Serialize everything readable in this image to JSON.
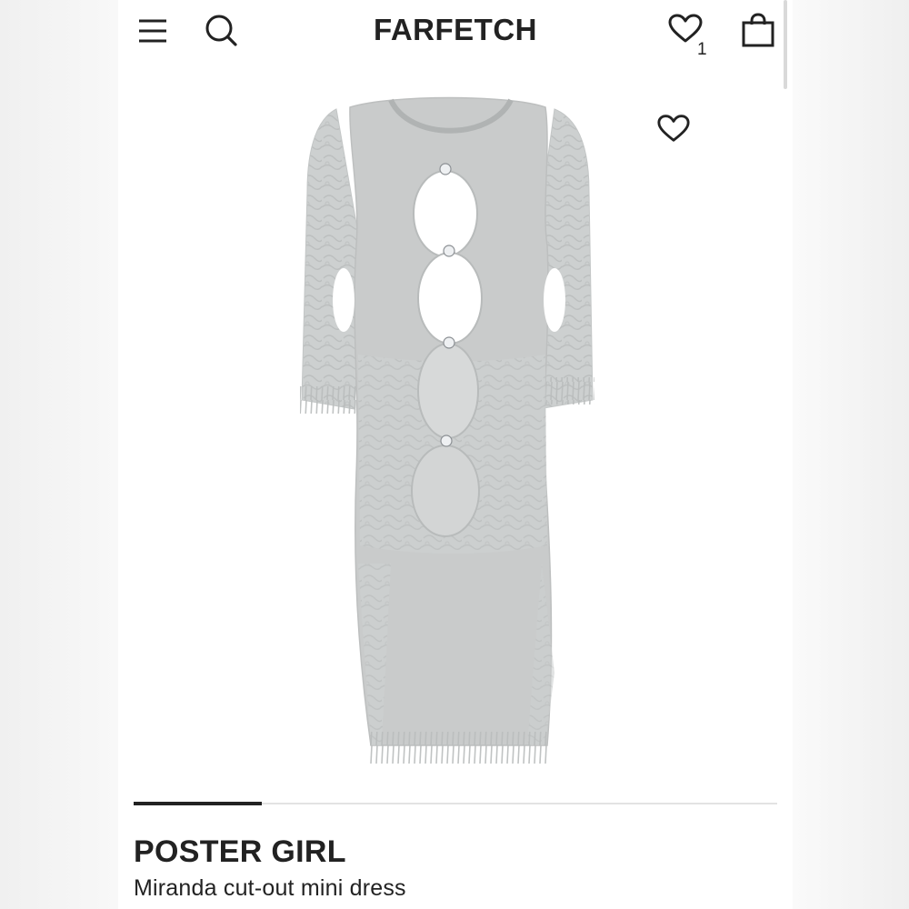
{
  "header": {
    "logo": "FARFETCH",
    "wishlist_count": "1",
    "icons": {
      "menu": "hamburger-menu-icon",
      "search": "search-icon",
      "wishlist": "heart-icon",
      "bag": "shopping-bag-icon"
    }
  },
  "product": {
    "brand": "POSTER GIRL",
    "name": "Miranda cut-out mini dress",
    "image_wishlist_icon": "heart-icon",
    "colors": {
      "dress": "#c9cbcb",
      "dress_shade": "#b9bbbb",
      "cutout": "#ffffff"
    }
  },
  "gallery": {
    "current_image": 1,
    "total_images": 5
  },
  "colors": {
    "text": "#222222",
    "background": "#ffffff",
    "track": "#e3e3e3"
  }
}
